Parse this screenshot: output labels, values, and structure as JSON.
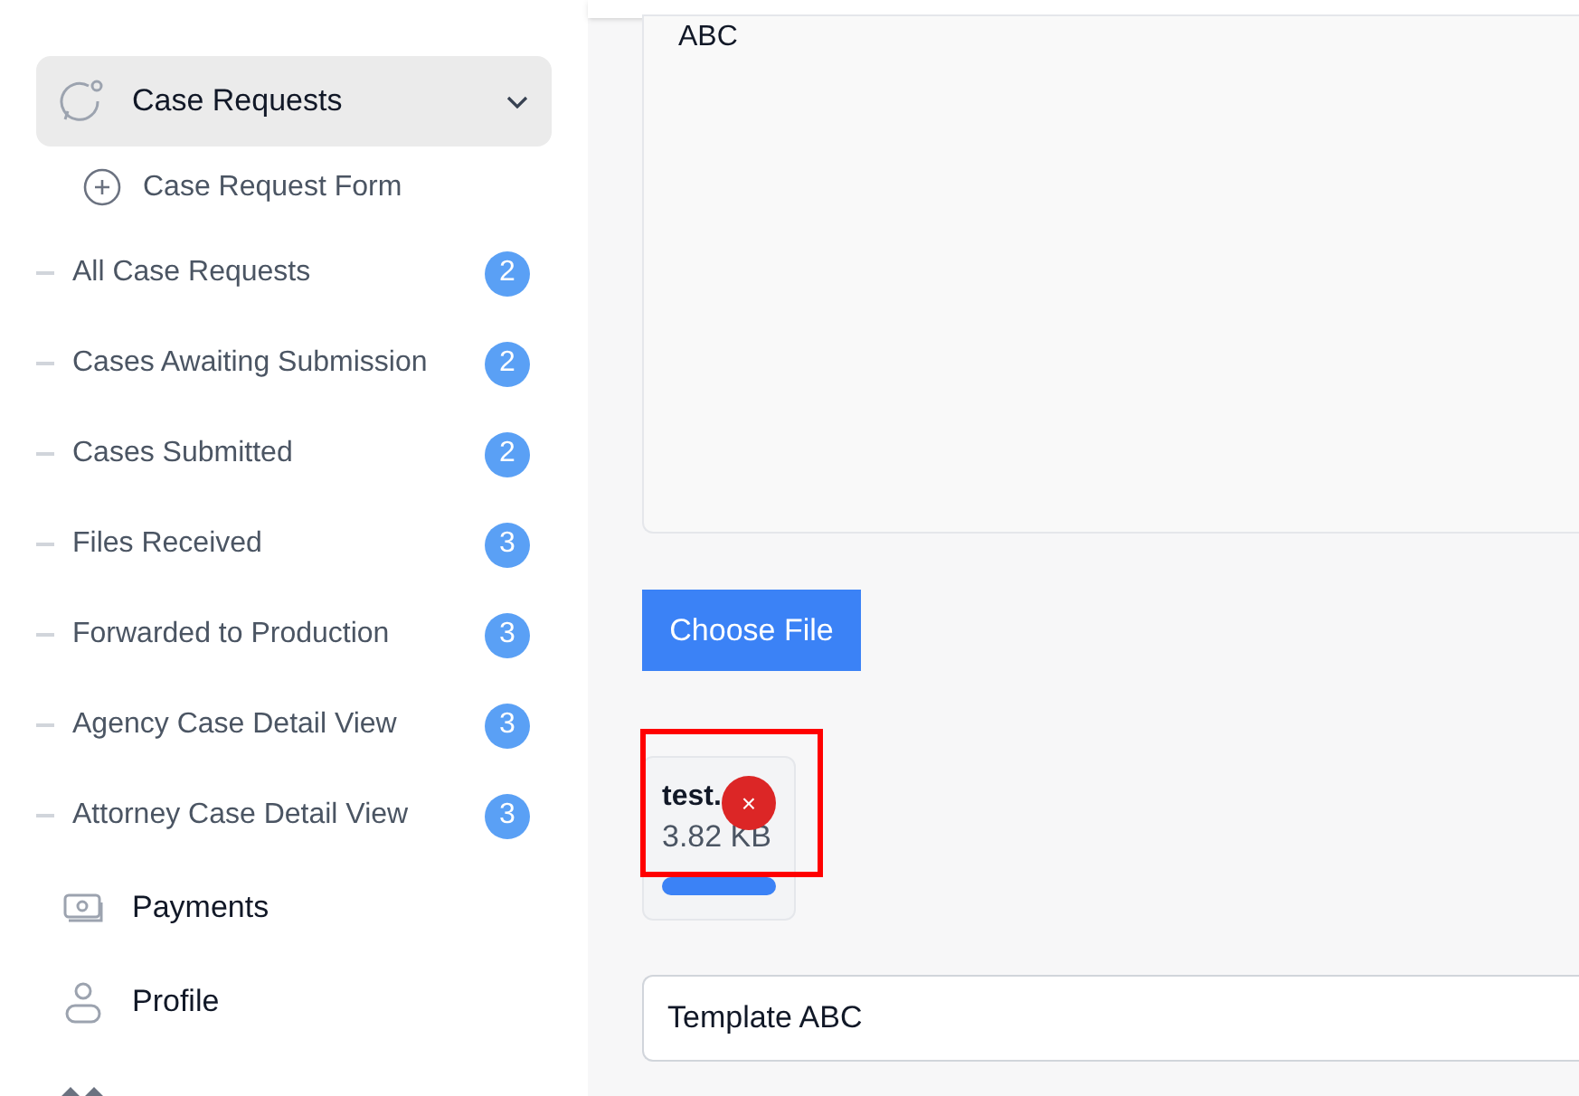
{
  "sidebar": {
    "group": {
      "label": "Case Requests",
      "expanded": true,
      "selected": true
    },
    "form_link": {
      "label": "Case Request Form"
    },
    "items": [
      {
        "label": "All Case Requests",
        "badge": "2"
      },
      {
        "label": "Cases Awaiting Submission",
        "badge": "2"
      },
      {
        "label": "Cases Submitted",
        "badge": "2"
      },
      {
        "label": "Files Received",
        "badge": "3"
      },
      {
        "label": "Forwarded to Production",
        "badge": "3"
      },
      {
        "label": "Agency Case Detail View",
        "badge": "3"
      },
      {
        "label": "Attorney Case Detail View",
        "badge": "3"
      }
    ],
    "nav": [
      {
        "kind": "payments",
        "label": "Payments"
      },
      {
        "kind": "profile",
        "label": "Profile"
      },
      {
        "kind": "deals"
      }
    ]
  },
  "form": {
    "description": "ABC",
    "upload_button": "Choose File",
    "file": {
      "name": "test.",
      "size": "3.82 KB",
      "remove": "×",
      "level": 1,
      "highlighted": true
    },
    "template": "Template ABC"
  }
}
